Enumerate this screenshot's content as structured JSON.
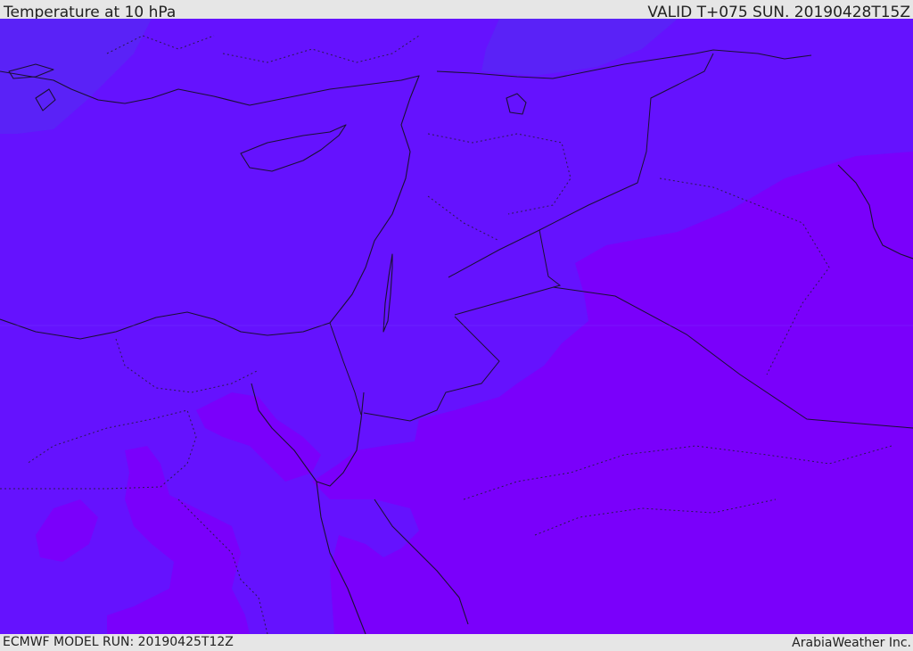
{
  "header": {
    "title": "Temperature at 10 hPa",
    "valid_time": "VALID T+075 SUN. 20190428T15Z"
  },
  "footer": {
    "model_run": "ECMWF MODEL RUN: 20190425T12Z",
    "credit": "ArabiaWeather Inc."
  },
  "map": {
    "colors": {
      "base_fill": "#6512fe",
      "cool_band": "#5a22f7",
      "warm_band": "#7a00fb",
      "coastline": "#1a1033",
      "border_dotted": "#2a1850"
    }
  }
}
